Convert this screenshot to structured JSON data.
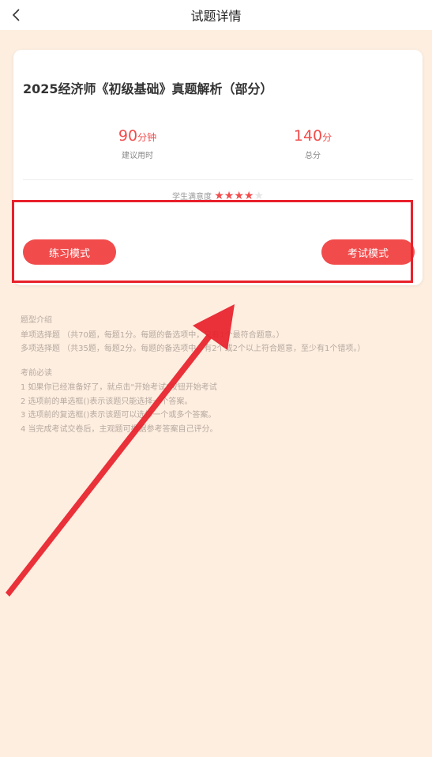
{
  "header": {
    "title": "试题详情"
  },
  "card": {
    "exam_title": "2025经济师《初级基础》真题解析（部分）",
    "duration": {
      "value": "90",
      "unit": "分钟",
      "label": "建议用时"
    },
    "total_score": {
      "value": "140",
      "unit": "分",
      "label": "总分"
    },
    "rating": {
      "label": "学生满意度",
      "stars": 4,
      "max": 5
    },
    "practice_button": "练习模式",
    "exam_button": "考试模式"
  },
  "info": {
    "types_title": "题型介绍",
    "single_choice": "单项选择题 （共70题，每题1分。每题的备选项中，只有1个最符合题意。）",
    "multiple_choice": "多项选择题 （共35题，每题2分。每题的备选项中，有2个或2个以上符合题意，至少有1个错项。）",
    "notes_title": "考前必读",
    "notes": [
      "1 如果你已经准备好了，就点击\"开始考试\"按钮开始考试",
      " 2 选项前的单选框()表示该题只能选择一个答案。",
      " 3 选项前的复选框()表示该题可以选择一个或多个答案。",
      " 4 当完成考试交卷后，主观题可根据参考答案自己评分。"
    ]
  },
  "annotation": {
    "color": "#e8202a"
  }
}
